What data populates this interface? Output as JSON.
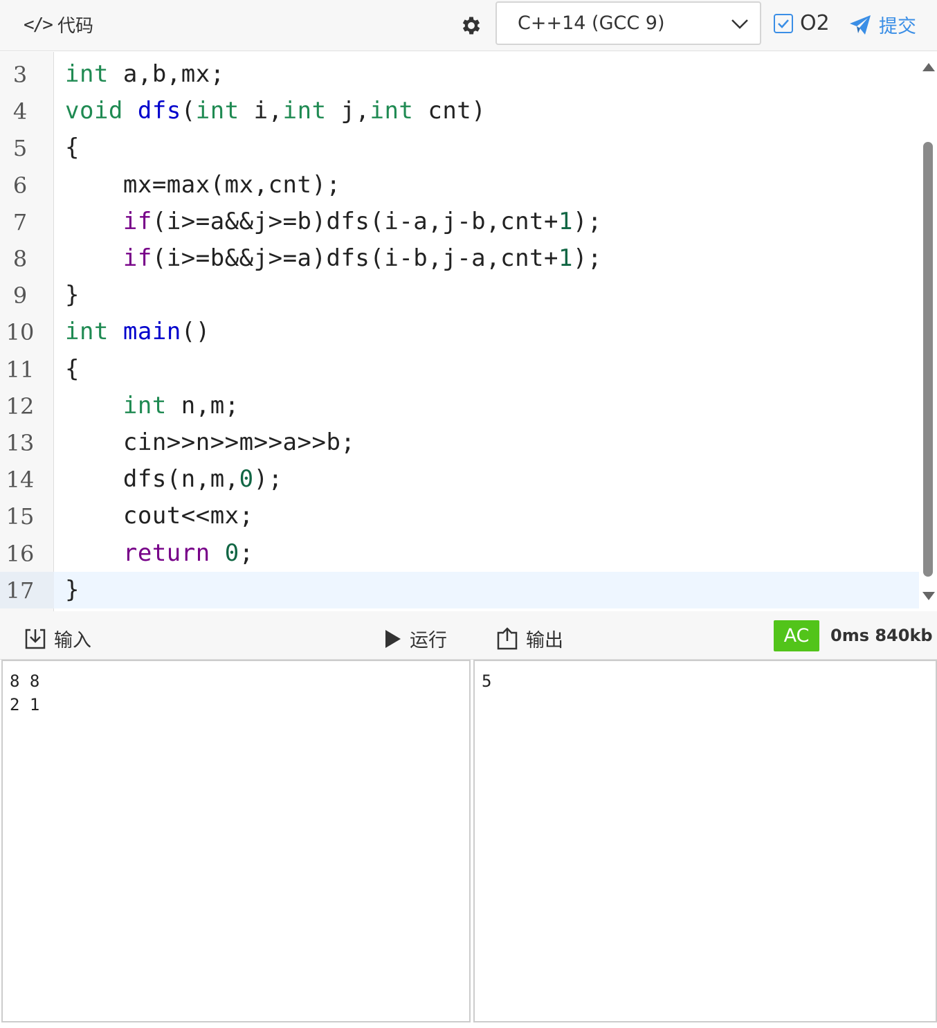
{
  "header": {
    "title": "代码",
    "language": "C++14 (GCC 9)",
    "o2_label": "O2",
    "submit_label": "提交"
  },
  "editor": {
    "lines": [
      {
        "n": "3",
        "code": "int a,b,mx;"
      },
      {
        "n": "4",
        "code": "void dfs(int i,int j,int cnt)"
      },
      {
        "n": "5",
        "code": "{"
      },
      {
        "n": "6",
        "code": "    mx=max(mx,cnt);"
      },
      {
        "n": "7",
        "code": "    if(i>=a&&j>=b)dfs(i-a,j-b,cnt+1);"
      },
      {
        "n": "8",
        "code": "    if(i>=b&&j>=a)dfs(i-b,j-a,cnt+1);"
      },
      {
        "n": "9",
        "code": "}"
      },
      {
        "n": "10",
        "code": "int main()"
      },
      {
        "n": "11",
        "code": "{"
      },
      {
        "n": "12",
        "code": "    int n,m;"
      },
      {
        "n": "13",
        "code": "    cin>>n>>m>>a>>b;"
      },
      {
        "n": "14",
        "code": "    dfs(n,m,0);"
      },
      {
        "n": "15",
        "code": "    cout<<mx;"
      },
      {
        "n": "16",
        "code": "    return 0;"
      },
      {
        "n": "17",
        "code": "}"
      }
    ],
    "active_line": "17"
  },
  "io": {
    "input_label": "输入",
    "run_label": "运行",
    "output_label": "输出",
    "status": "AC",
    "stats": "0ms 840kb",
    "input_value": "8 8\n2 1",
    "output_value": "5"
  },
  "colors": {
    "accent": "#3a8ee6",
    "ac_green": "#52c41a",
    "type_keyword": "#1f8a52",
    "function_name": "#0000cc",
    "control_keyword": "#770088"
  }
}
